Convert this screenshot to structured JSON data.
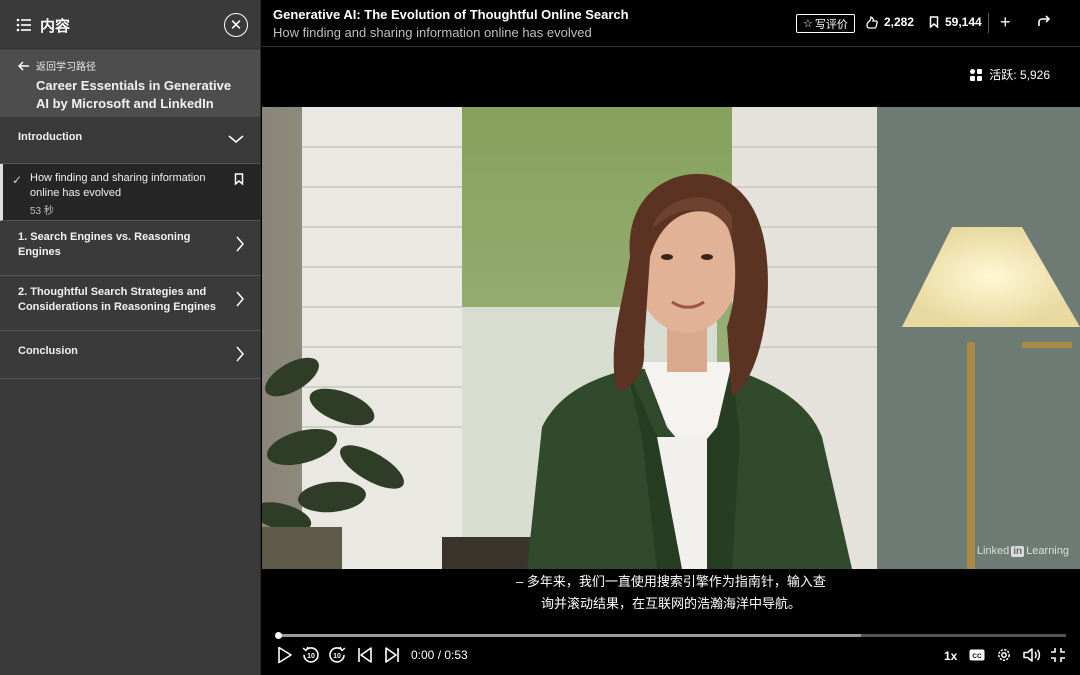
{
  "sidebar": {
    "title": "内容",
    "back_label": "返回学习路径",
    "course_title": "Career Essentials in Generative AI by Microsoft and LinkedIn",
    "sections": [
      {
        "label": "Introduction"
      },
      {
        "label": "1. Search Engines vs. Reasoning Engines"
      },
      {
        "label": "2. Thoughtful Search Strategies and Considerations in Reasoning Engines"
      },
      {
        "label": "Conclusion"
      }
    ],
    "current_video": {
      "title": "How finding and sharing information online has evolved",
      "duration": "53 秒",
      "completed": true
    }
  },
  "header": {
    "title": "Generative AI: The Evolution of Thoughtful Online Search",
    "subtitle": "How finding and sharing information online has evolved",
    "review_label": "写评价",
    "likes": "2,282",
    "saves": "59,144"
  },
  "player": {
    "active_label": "活跃: 5,926",
    "watermark_pre": "Linked",
    "watermark_in": "in",
    "watermark_post": "Learning",
    "subtitle_line1": "– 多年来，我们一直使用搜索引擎作为指南针，输入查",
    "subtitle_line2": "询并滚动结果，在互联网的浩瀚海洋中导航。",
    "time": "0:00 / 0:53",
    "speed": "1x",
    "progress": 0.0,
    "buffered": 0.74,
    "rewind_seconds": "10",
    "forward_seconds": "10"
  },
  "icons": [
    "list-icon",
    "close-icon",
    "back-arrow-icon",
    "chevron-down-icon",
    "chevron-right-icon",
    "check-icon",
    "bookmark-icon",
    "star-icon",
    "like-icon",
    "plus-icon",
    "share-icon",
    "people-icon",
    "play-icon",
    "rewind-10-icon",
    "forward-10-icon",
    "previous-icon",
    "next-icon",
    "captions-icon",
    "settings-icon",
    "volume-icon",
    "exit-fullscreen-icon"
  ]
}
